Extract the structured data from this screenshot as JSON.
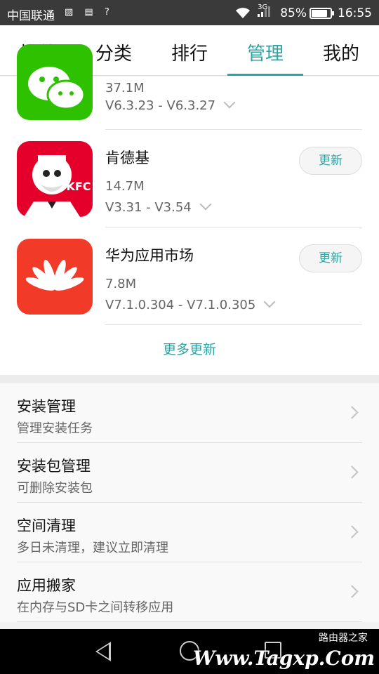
{
  "status_bar": {
    "carrier": "中国联通",
    "network": "3G",
    "battery": "85%",
    "battery_level": 0.85,
    "time": "16:55"
  },
  "tabs": [
    {
      "label": "推荐",
      "active": false
    },
    {
      "label": "分类",
      "active": false
    },
    {
      "label": "排行",
      "active": false
    },
    {
      "label": "管理",
      "active": true
    },
    {
      "label": "我的",
      "active": false
    }
  ],
  "updates": [
    {
      "name": "",
      "size": "37.1M",
      "version": "V6.3.23 - V6.3.27",
      "icon": "wechat-icon",
      "color": "#2dc100"
    },
    {
      "name": "肯德基",
      "size": "14.7M",
      "version": "V3.31 - V3.54",
      "button": "更新",
      "icon": "kfc-icon",
      "color": "#e4002b"
    },
    {
      "name": "华为应用市场",
      "size": "7.8M",
      "version": "V7.1.0.304 - V7.1.0.305",
      "button": "更新",
      "icon": "huawei-icon",
      "color": "#f23a28"
    }
  ],
  "more_updates": "更多更新",
  "manage_items": [
    {
      "title": "安装管理",
      "subtitle": "管理安装任务"
    },
    {
      "title": "安装包管理",
      "subtitle": "可删除安装包"
    },
    {
      "title": "空间清理",
      "subtitle": "多日未清理，建议立即清理"
    },
    {
      "title": "应用搬家",
      "subtitle": "在内存与SD卡之间转移应用"
    }
  ],
  "watermark": "Www.Tagxp.Com",
  "watermark_small": "路由器之家",
  "accent_color": "#2aa6a6"
}
